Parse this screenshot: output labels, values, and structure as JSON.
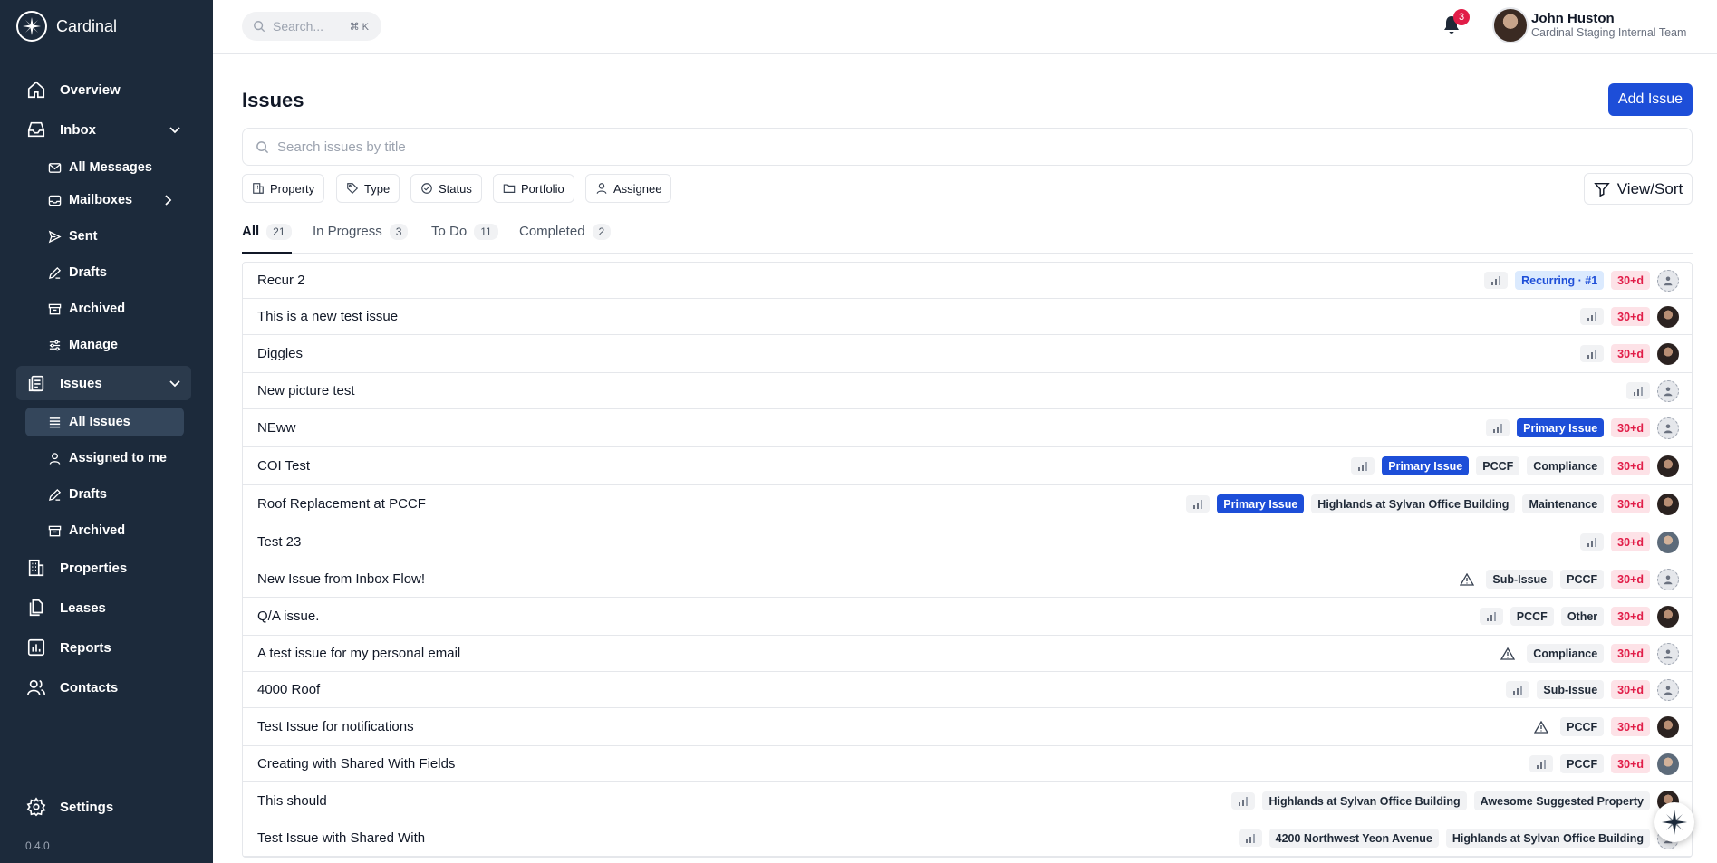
{
  "app": {
    "name": "Cardinal",
    "version": "0.4.0"
  },
  "topbar": {
    "search_placeholder": "Search...",
    "search_shortcut": "⌘ K",
    "notification_count": "3",
    "user": {
      "name": "John Huston",
      "team": "Cardinal Staging Internal Team"
    }
  },
  "sidebar": {
    "overview": "Overview",
    "inbox": "Inbox",
    "inbox_items": [
      "All Messages",
      "Mailboxes",
      "Sent",
      "Drafts",
      "Archived",
      "Manage"
    ],
    "issues": "Issues",
    "issue_items": [
      "All Issues",
      "Assigned to me",
      "Drafts",
      "Archived"
    ],
    "properties": "Properties",
    "leases": "Leases",
    "reports": "Reports",
    "contacts": "Contacts",
    "settings": "Settings"
  },
  "main": {
    "title": "Issues",
    "add_button": "Add Issue",
    "search_placeholder": "Search issues by title",
    "filters": [
      "Property",
      "Type",
      "Status",
      "Portfolio",
      "Assignee"
    ],
    "view_sort": "View/Sort",
    "tabs": [
      {
        "label": "All",
        "count": "21"
      },
      {
        "label": "In Progress",
        "count": "3"
      },
      {
        "label": "To Do",
        "count": "11"
      },
      {
        "label": "Completed",
        "count": "2"
      }
    ]
  },
  "issues": [
    {
      "title": "Recur 2",
      "priority": "bars",
      "tags": [
        {
          "text": "Recurring · #1",
          "kind": "recurring"
        }
      ],
      "age": "30+d",
      "avatar": "empty"
    },
    {
      "title": "This is a new test issue",
      "priority": "bars",
      "tags": [],
      "age": "30+d",
      "avatar": "photo"
    },
    {
      "title": "Diggles",
      "priority": "bars",
      "tags": [],
      "age": "30+d",
      "avatar": "photo"
    },
    {
      "title": "New picture test",
      "priority": "bars",
      "tags": [],
      "age": "",
      "avatar": "empty"
    },
    {
      "title": "NEww",
      "priority": "bars",
      "tags": [
        {
          "text": "Primary Issue",
          "kind": "primary"
        }
      ],
      "age": "30+d",
      "avatar": "empty"
    },
    {
      "title": "COI Test",
      "priority": "bars",
      "tags": [
        {
          "text": "Primary Issue",
          "kind": "primary"
        },
        {
          "text": "PCCF",
          "kind": "plain"
        },
        {
          "text": "Compliance",
          "kind": "plain"
        }
      ],
      "age": "30+d",
      "avatar": "photo"
    },
    {
      "title": "Roof Replacement at PCCF",
      "priority": "bars",
      "tags": [
        {
          "text": "Primary Issue",
          "kind": "primary"
        },
        {
          "text": "Highlands at Sylvan Office Building",
          "kind": "plain"
        },
        {
          "text": "Maintenance",
          "kind": "plain"
        }
      ],
      "age": "30+d",
      "avatar": "photo"
    },
    {
      "title": "Test 23",
      "priority": "bars",
      "tags": [],
      "age": "30+d",
      "avatar": "photo2"
    },
    {
      "title": "New Issue from Inbox Flow!",
      "priority": "warn",
      "tags": [
        {
          "text": "Sub-Issue",
          "kind": "plain"
        },
        {
          "text": "PCCF",
          "kind": "plain"
        }
      ],
      "age": "30+d",
      "avatar": "empty"
    },
    {
      "title": "Q/A issue.",
      "priority": "bars",
      "tags": [
        {
          "text": "PCCF",
          "kind": "plain"
        },
        {
          "text": "Other",
          "kind": "plain"
        }
      ],
      "age": "30+d",
      "avatar": "photo"
    },
    {
      "title": "A test issue for my personal email",
      "priority": "warn",
      "tags": [
        {
          "text": "Compliance",
          "kind": "plain"
        }
      ],
      "age": "30+d",
      "avatar": "empty"
    },
    {
      "title": "4000 Roof",
      "priority": "bars",
      "tags": [
        {
          "text": "Sub-Issue",
          "kind": "plain"
        }
      ],
      "age": "30+d",
      "avatar": "empty"
    },
    {
      "title": "Test Issue for notifications",
      "priority": "warn",
      "tags": [
        {
          "text": "PCCF",
          "kind": "plain"
        }
      ],
      "age": "30+d",
      "avatar": "photo"
    },
    {
      "title": "Creating with Shared With Fields",
      "priority": "bars",
      "tags": [
        {
          "text": "PCCF",
          "kind": "plain"
        }
      ],
      "age": "30+d",
      "avatar": "photo2"
    },
    {
      "title": "This should",
      "priority": "bars",
      "tags": [
        {
          "text": "Highlands at Sylvan Office Building",
          "kind": "plain"
        },
        {
          "text": "Awesome Suggested Property",
          "kind": "plain"
        }
      ],
      "age": "",
      "avatar": "photo"
    },
    {
      "title": "Test Issue with Shared With",
      "priority": "bars",
      "tags": [
        {
          "text": "4200 Northwest Yeon Avenue",
          "kind": "plain"
        },
        {
          "text": "Highlands at Sylvan Office Building",
          "kind": "plain"
        }
      ],
      "age": "",
      "avatar": "empty"
    }
  ]
}
